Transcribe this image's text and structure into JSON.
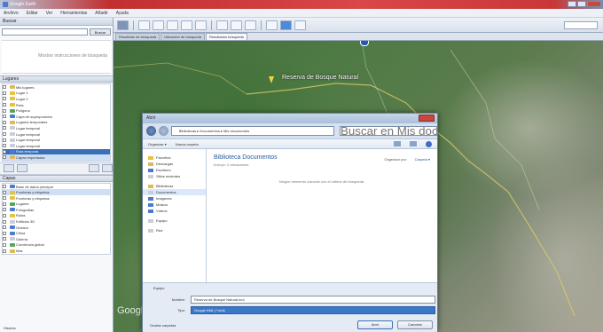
{
  "window": {
    "title": "Google Earth",
    "colors": {
      "title_accent": "#c83838",
      "map_green": "#4e7a44",
      "selection": "#3a6fb8"
    }
  },
  "menu": [
    "Archivo",
    "Editar",
    "Ver",
    "Herramientas",
    "Añadir",
    "Ayuda"
  ],
  "search": {
    "header": "Buscar",
    "button": "Buscar",
    "hint": "Mostrar instrucciones de búsqueda"
  },
  "places": {
    "header": "Lugares",
    "items": [
      {
        "label": "Mis lugares",
        "icon": "folder-icon",
        "state": "normal"
      },
      {
        "label": "Lugar 1",
        "icon": "placemark-icon",
        "state": "normal"
      },
      {
        "label": "Lugar 2",
        "icon": "placemark-icon",
        "state": "normal"
      },
      {
        "label": "Ruta",
        "icon": "path-icon",
        "state": "normal"
      },
      {
        "label": "Polígono",
        "icon": "polygon-icon",
        "state": "normal"
      },
      {
        "label": "Capa de superposición",
        "icon": "overlay-icon",
        "state": "normal"
      },
      {
        "label": "Lugares temporales",
        "icon": "folder-icon",
        "state": "normal"
      },
      {
        "label": "Lugar temporal",
        "icon": "placemark-icon",
        "state": "normal"
      },
      {
        "label": "Lugar temporal",
        "icon": "placemark-icon",
        "state": "normal"
      },
      {
        "label": "Lugar temporal",
        "icon": "placemark-icon",
        "state": "normal"
      },
      {
        "label": "Lugar temporal",
        "icon": "placemark-icon",
        "state": "normal"
      },
      {
        "label": "Ruta temporal",
        "icon": "path-icon",
        "state": "selected"
      },
      {
        "label": "Capas importadas",
        "icon": "folder-icon",
        "state": "light"
      }
    ]
  },
  "layers": {
    "header": "Capas",
    "items": [
      {
        "label": "Base de datos principal",
        "icon": "globe-icon"
      },
      {
        "label": "Fronteras y etiquetas",
        "icon": "border-icon"
      },
      {
        "label": "Fronteras y etiquetas",
        "icon": "border-icon"
      },
      {
        "label": "Lugares",
        "icon": "place-icon"
      },
      {
        "label": "Fotografías",
        "icon": "photo-icon"
      },
      {
        "label": "Rutas",
        "icon": "road-icon"
      },
      {
        "label": "Edificios 3D",
        "icon": "building-icon"
      },
      {
        "label": "Océano",
        "icon": "ocean-icon"
      },
      {
        "label": "Clima",
        "icon": "weather-icon"
      },
      {
        "label": "Galería",
        "icon": "gallery-icon"
      },
      {
        "label": "Conciencia global",
        "icon": "globe-icon"
      },
      {
        "label": "Más",
        "icon": "more-icon"
      }
    ]
  },
  "status": {
    "bottom_left": "Historia"
  },
  "tabs": [
    {
      "label": "Resultado de búsqueda",
      "active": false
    },
    {
      "label": "Ubicación de búsqueda",
      "active": false
    },
    {
      "label": "Resultados búsqueda",
      "active": true
    }
  ],
  "map": {
    "place_label": "Reserva de Bosque Natural",
    "watermark": "Google"
  },
  "dialog": {
    "title": "Abrir",
    "path": "Bibliotecas ▸ Documentos ▸ Mis documentos",
    "search_placeholder": "Buscar en Mis documentos",
    "organize": "Organizar ▾",
    "new_folder": "Nueva carpeta",
    "nav_items": [
      {
        "label": "Favoritos",
        "icon": "star-icon",
        "hdr": true
      },
      {
        "label": "Descargas",
        "icon": "download-icon"
      },
      {
        "label": "Escritorio",
        "icon": "desktop-icon"
      },
      {
        "label": "Sitios recientes",
        "icon": "recent-icon"
      },
      {
        "label": "Bibliotecas",
        "icon": "library-icon",
        "hdr": true
      },
      {
        "label": "Documentos",
        "icon": "document-icon",
        "sel": true
      },
      {
        "label": "Imágenes",
        "icon": "picture-icon"
      },
      {
        "label": "Música",
        "icon": "music-icon"
      },
      {
        "label": "Vídeos",
        "icon": "video-icon"
      },
      {
        "label": "Equipo",
        "icon": "computer-icon",
        "hdr": true
      },
      {
        "label": "Red",
        "icon": "network-icon",
        "hdr": true
      }
    ],
    "library_title": "Biblioteca Documentos",
    "library_subtitle": "Incluye: 2 ubicaciones",
    "arrange_label": "Organizar por:",
    "arrange_value": "Carpeta ▾",
    "empty_message": "Ningún elemento coincide con el criterio de búsqueda.",
    "filename_label": "Nombre:",
    "filename_value": "Reserva de Bosque Natural.kml",
    "filetype_label": "Tipo:",
    "filetype_value": "Google KML (*.kml)",
    "browse_label": "Equipo",
    "hide_folders": "Ocultar carpetas",
    "open_button": "Abrir",
    "cancel_button": "Cancelar"
  }
}
